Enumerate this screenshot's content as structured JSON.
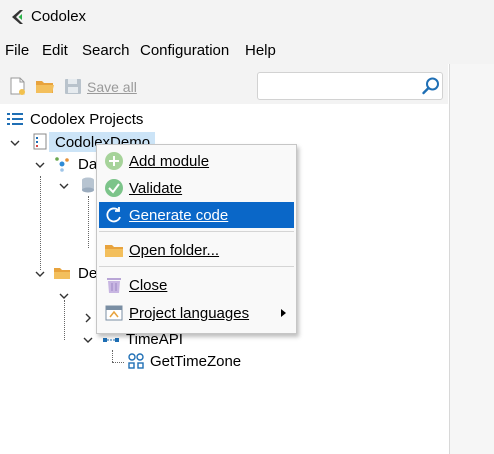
{
  "window": {
    "title": "Codolex",
    "logo_icon": "codolex-logo-icon"
  },
  "menu": [
    "File",
    "Edit",
    "Search",
    "Configuration",
    "Help"
  ],
  "toolbar": {
    "new_icon": "new-file-icon",
    "open_icon": "open-folder-icon",
    "save_all_icon": "save-icon",
    "save_all_label": "Save all",
    "search_value": "",
    "search_placeholder": "",
    "search_icon": "search-icon"
  },
  "tree": {
    "root_label": "Codolex Projects",
    "project_label": "CodolexDemo",
    "node_da": "Da",
    "node_de": "De",
    "node_timeapi": "TimeAPI",
    "node_gettimezone": "GetTimeZone"
  },
  "context_menu": {
    "items": [
      {
        "label": "Add module",
        "icon": "plus-circle-icon"
      },
      {
        "label": "Validate",
        "icon": "check-circle-icon"
      },
      {
        "label": "Generate code",
        "icon": "refresh-icon"
      },
      {
        "label": "Open folder...",
        "icon": "folder-icon"
      },
      {
        "label": "Close",
        "icon": "trash-icon"
      },
      {
        "label": "Project languages",
        "icon": "languages-icon"
      }
    ]
  },
  "colors": {
    "highlight": "#0a67c8",
    "selection": "#cce4f7",
    "accent": "#1f6fb5"
  }
}
